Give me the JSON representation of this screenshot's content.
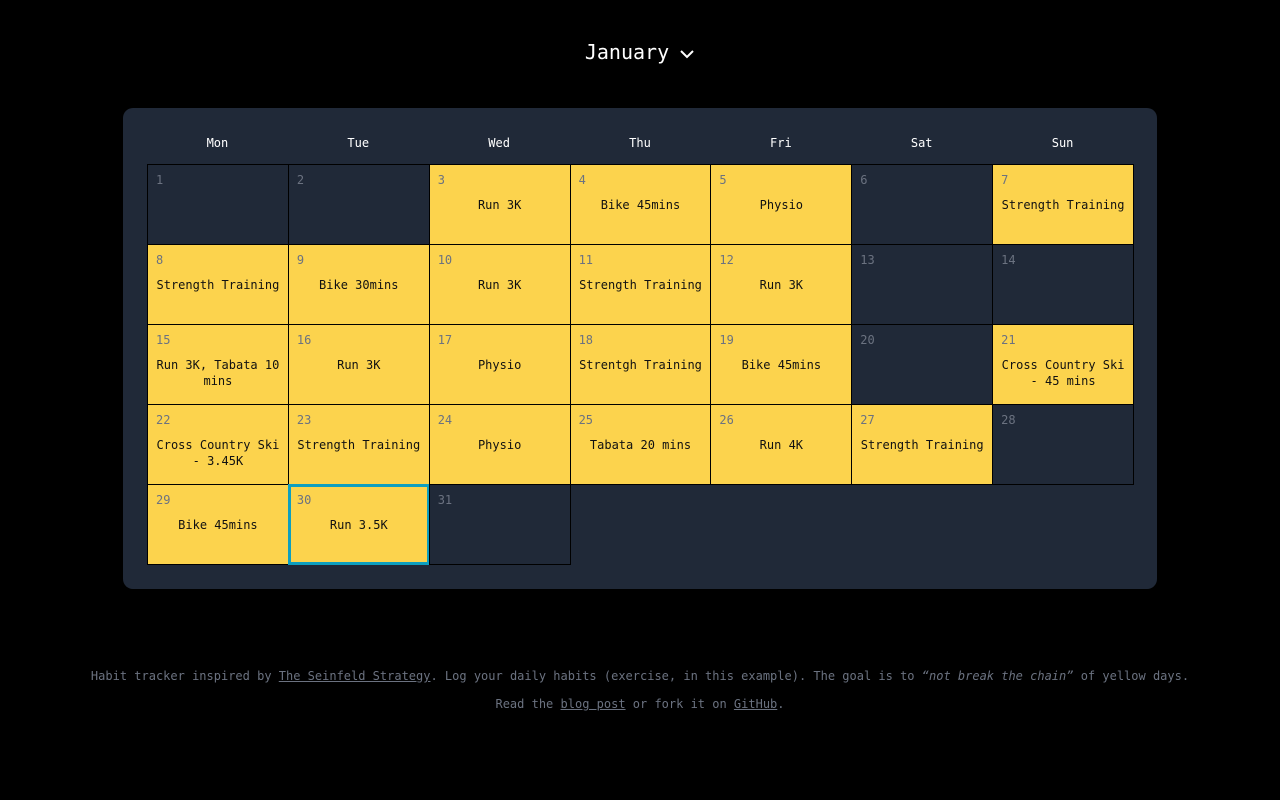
{
  "header": {
    "month": "January"
  },
  "weekdays": [
    "Mon",
    "Tue",
    "Wed",
    "Thu",
    "Fri",
    "Sat",
    "Sun"
  ],
  "days": [
    {
      "day": "1",
      "activity": ""
    },
    {
      "day": "2",
      "activity": ""
    },
    {
      "day": "3",
      "activity": "Run 3K"
    },
    {
      "day": "4",
      "activity": "Bike 45mins"
    },
    {
      "day": "5",
      "activity": "Physio"
    },
    {
      "day": "6",
      "activity": ""
    },
    {
      "day": "7",
      "activity": "Strength Training"
    },
    {
      "day": "8",
      "activity": "Strength Training"
    },
    {
      "day": "9",
      "activity": "Bike 30mins"
    },
    {
      "day": "10",
      "activity": "Run 3K"
    },
    {
      "day": "11",
      "activity": "Strength Training"
    },
    {
      "day": "12",
      "activity": "Run 3K"
    },
    {
      "day": "13",
      "activity": ""
    },
    {
      "day": "14",
      "activity": ""
    },
    {
      "day": "15",
      "activity": "Run 3K, Tabata 10 mins"
    },
    {
      "day": "16",
      "activity": "Run 3K"
    },
    {
      "day": "17",
      "activity": "Physio"
    },
    {
      "day": "18",
      "activity": "Strentgh Training"
    },
    {
      "day": "19",
      "activity": "Bike 45mins"
    },
    {
      "day": "20",
      "activity": ""
    },
    {
      "day": "21",
      "activity": "Cross Country Ski - 45 mins"
    },
    {
      "day": "22",
      "activity": "Cross Country Ski - 3.45K"
    },
    {
      "day": "23",
      "activity": "Strength Training"
    },
    {
      "day": "24",
      "activity": "Physio"
    },
    {
      "day": "25",
      "activity": "Tabata 20 mins"
    },
    {
      "day": "26",
      "activity": "Run 4K"
    },
    {
      "day": "27",
      "activity": "Strength Training"
    },
    {
      "day": "28",
      "activity": ""
    },
    {
      "day": "29",
      "activity": "Bike 45mins"
    },
    {
      "day": "30",
      "activity": "Run 3.5K",
      "selected": true
    },
    {
      "day": "31",
      "activity": ""
    }
  ],
  "footer": {
    "line1_a": "Habit tracker inspired by ",
    "link_seinfeld": "The Seinfeld Strategy",
    "line1_b": ". Log your daily habits (exercise, in this example). The goal is to ",
    "quote": "“not break the chain”",
    "line1_c": " of yellow days.",
    "line2_a": "Read the ",
    "link_blog": "blog post",
    "line2_b": " or fork it on ",
    "link_github": "GitHub",
    "line2_c": "."
  },
  "colors": {
    "done": "#fcd34d",
    "empty": "#202938",
    "selected": "#0e9fbf"
  }
}
